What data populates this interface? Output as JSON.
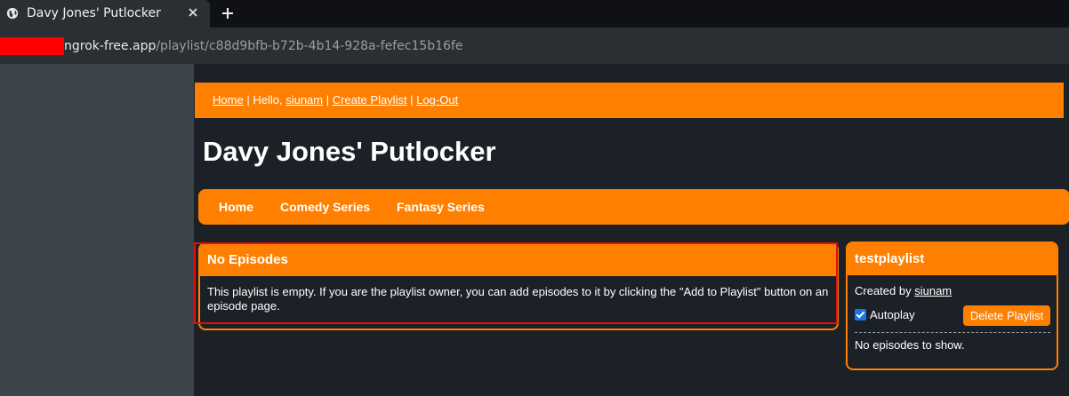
{
  "browser": {
    "tab_title": "Davy Jones' Putlocker",
    "url_host": "ngrok-free.app",
    "url_path": "/playlist/c88d9bfb-b72b-4b14-928a-fefec15b16fe"
  },
  "topbar": {
    "home": "Home",
    "hello": "Hello,",
    "username": "siunam",
    "create_playlist": "Create Playlist",
    "logout": "Log-Out",
    "separator": "|"
  },
  "site_title": "Davy Jones' Putlocker",
  "nav": {
    "items": [
      {
        "label": "Home"
      },
      {
        "label": "Comedy Series"
      },
      {
        "label": "Fantasy Series"
      }
    ]
  },
  "main": {
    "heading": "No Episodes",
    "message": "This playlist is empty. If you are the playlist owner, you can add episodes to it by clicking the \"Add to Playlist\" button on an episode page."
  },
  "sidebar": {
    "playlist_name": "testplaylist",
    "created_by_label": "Created by",
    "created_by_user": "siunam",
    "autoplay_label": "Autoplay",
    "autoplay_checked": true,
    "delete_button": "Delete Playlist",
    "empty_text": "No episodes to show."
  },
  "colors": {
    "accent": "#ff8000",
    "background": "#1c2128",
    "gutter": "#3c434a",
    "highlight": "#e01010"
  }
}
